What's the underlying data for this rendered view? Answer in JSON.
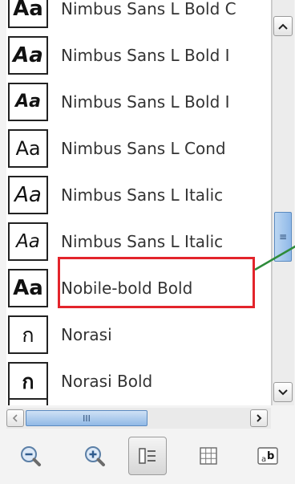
{
  "font_list": {
    "items": [
      {
        "preview": "Aa",
        "style": "bold",
        "name": "Nimbus Sans L Bold C",
        "selected": false
      },
      {
        "preview": "Aa",
        "style": "bold-italic",
        "name": "Nimbus Sans L Bold I",
        "selected": false
      },
      {
        "preview": "Aa",
        "style": "bold-italic",
        "name": "Nimbus Sans L Bold I",
        "selected": false
      },
      {
        "preview": "Aa",
        "style": "regular",
        "name": "Nimbus Sans L Cond",
        "selected": false
      },
      {
        "preview": "Aa",
        "style": "italic",
        "name": "Nimbus Sans L Italic",
        "selected": false
      },
      {
        "preview": "Aa",
        "style": "italic",
        "name": "Nimbus Sans L Italic",
        "selected": false
      },
      {
        "preview": "Aa",
        "style": "bold",
        "name": "Nobile-bold Bold",
        "selected": true
      },
      {
        "preview": "ก",
        "style": "thai",
        "name": "Norasi",
        "selected": false
      },
      {
        "preview": "ก",
        "style": "thai-bold",
        "name": "Norasi Bold",
        "selected": false
      }
    ]
  },
  "vertical_scrollbar": {
    "up_icon": "chevron-up-icon",
    "down_icon": "chevron-down-icon",
    "grip": "≡"
  },
  "horizontal_scrollbar": {
    "left_icon": "chevron-left-icon",
    "right_icon": "chevron-right-icon",
    "grip": "III"
  },
  "toolbar": {
    "buttons": [
      {
        "icon": "zoom-out-icon",
        "active": false
      },
      {
        "icon": "zoom-in-icon",
        "active": false
      },
      {
        "icon": "list-view-icon",
        "active": true
      },
      {
        "icon": "grid-view-icon",
        "active": false
      },
      {
        "icon": "text-preview-icon",
        "label": "ab",
        "active": false
      }
    ]
  },
  "colors": {
    "highlight": "#e3242b",
    "callout": "#2e8b3a",
    "accent": "#3a86d6"
  }
}
